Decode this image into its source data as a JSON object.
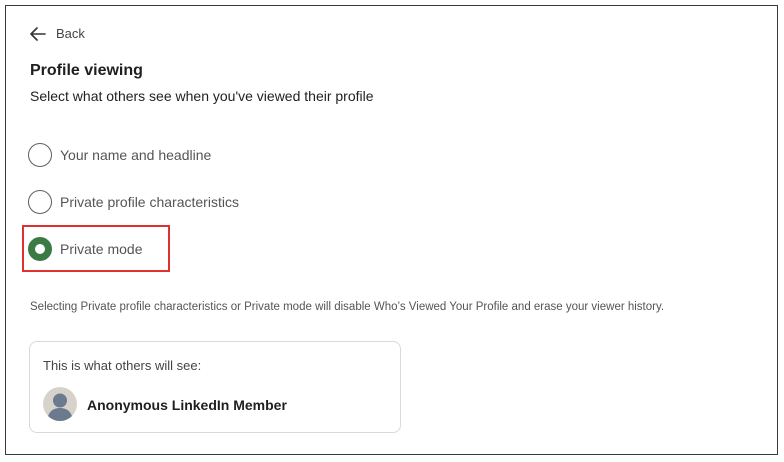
{
  "nav": {
    "back_label": "Back"
  },
  "header": {
    "title": "Profile viewing",
    "subtitle": "Select what others see when you've viewed their profile"
  },
  "options": [
    {
      "label": "Your name and headline",
      "selected": false
    },
    {
      "label": "Private profile characteristics",
      "selected": false
    },
    {
      "label": "Private mode",
      "selected": true
    }
  ],
  "note": "Selecting Private profile characteristics or Private mode will disable Who’s Viewed Your Profile and erase your viewer history.",
  "preview": {
    "title": "This is what others will see:",
    "member_name": "Anonymous LinkedIn Member",
    "avatar_icon": "anonymous-avatar-icon"
  },
  "colors": {
    "accent": "#3b7a45",
    "highlight": "#e03131"
  }
}
